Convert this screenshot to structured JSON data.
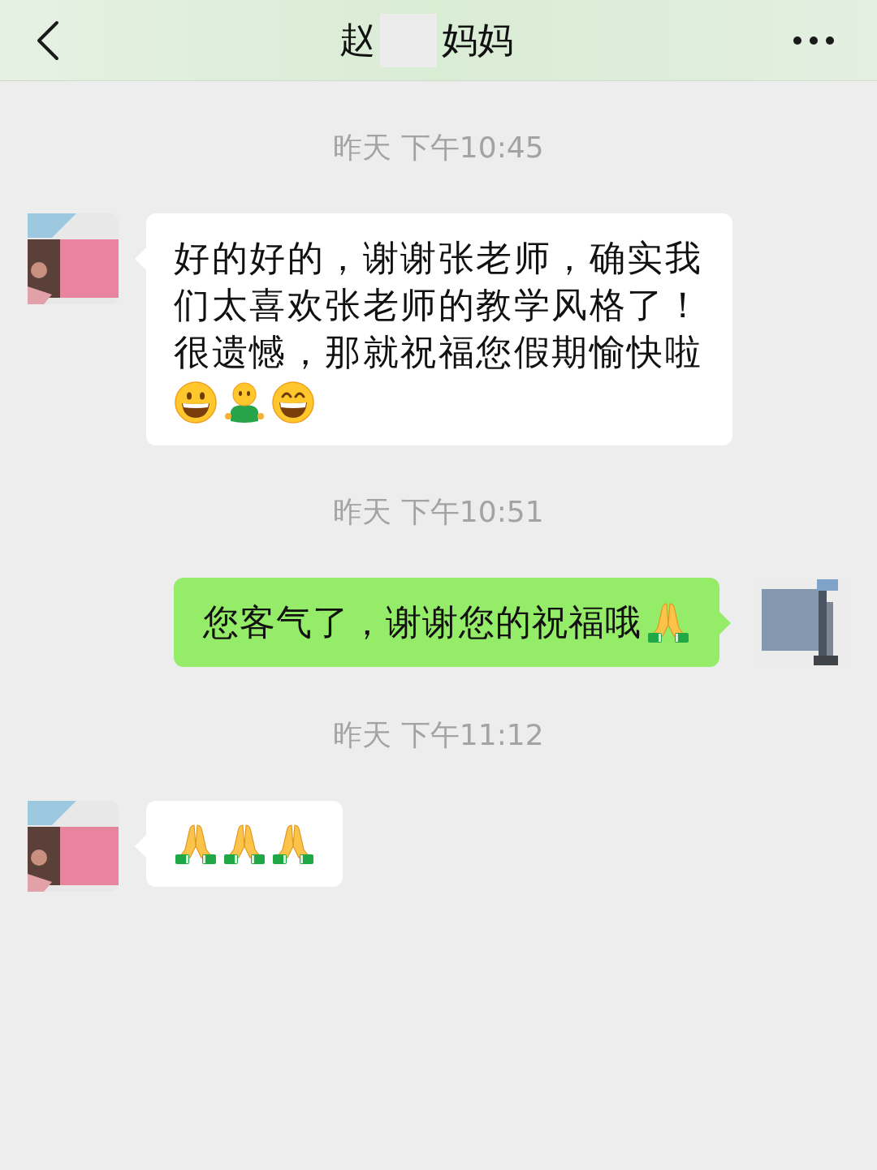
{
  "header": {
    "title_start": "赵",
    "title_end": "妈妈"
  },
  "messages": [
    {
      "kind": "timestamp",
      "text": "昨天 下午10:45"
    },
    {
      "kind": "incoming",
      "content": [
        {
          "kind": "text",
          "text": "好的好的，谢谢张老师，确实我们太喜欢张老师的教学风格了！很遗憾，那就祝福您假期愉快啦"
        },
        {
          "kind": "grin"
        },
        {
          "kind": "person"
        },
        {
          "kind": "beam"
        }
      ]
    },
    {
      "kind": "timestamp",
      "text": "昨天 下午10:51"
    },
    {
      "kind": "outgoing",
      "content": [
        {
          "kind": "text",
          "text": "您客气了，谢谢您的祝福哦"
        },
        {
          "kind": "pray"
        }
      ]
    },
    {
      "kind": "timestamp",
      "text": "昨天 下午11:12"
    },
    {
      "kind": "incoming",
      "content": [
        {
          "kind": "pray"
        },
        {
          "kind": "pray"
        },
        {
          "kind": "pray"
        }
      ]
    }
  ]
}
